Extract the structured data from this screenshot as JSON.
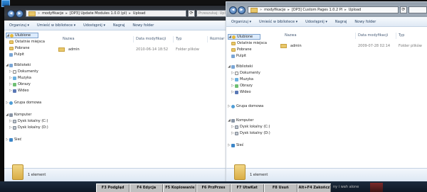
{
  "window_a": {
    "address": [
      "modyfikacje",
      "[DP3] Update Modules 1.0.0 (pl)",
      "Upload"
    ],
    "search_placeholder": "Przeszukaj: Upload",
    "toolbar": {
      "organize": "Organizuj ▾",
      "library": "Umieść w bibliotece ▾",
      "share": "Udostępnij ▾",
      "burn": "Nagraj",
      "new_folder": "Nowy folder"
    },
    "columns": {
      "name": "Nazwa",
      "date": "Data modyfikacji",
      "type": "Typ",
      "size": "Rozmiar"
    },
    "rows": [
      {
        "name": "admin",
        "date": "2010-06-14 18:52",
        "type": "Folder plików"
      }
    ],
    "status": "1 element"
  },
  "window_b": {
    "address": [
      "modyfikacje",
      "[DP3] Custom Pages 1.0.2 Pl",
      "Upload"
    ],
    "toolbar": {
      "organize": "Organizuj ▾",
      "library": "Umieść w bibliotece ▾",
      "share": "Udostępnij ▾",
      "burn": "Nagraj",
      "new_folder": "Nowy folder"
    },
    "columns": {
      "name": "Nazwa",
      "date": "Data modyfikacji",
      "type": "Typ"
    },
    "rows": [
      {
        "name": "admin",
        "date": "2009-07-28 02:14",
        "type": "Folder plików"
      }
    ],
    "status": "1 element"
  },
  "sidebar": {
    "favorites": "Ulubione",
    "recent": "Ostatnie miejsca",
    "downloads": "Pobrane",
    "desktop": "Pulpit",
    "libraries": "Biblioteki",
    "documents": "Dokumenty",
    "music": "Muzyka",
    "pictures": "Obrazy",
    "videos": "Wideo",
    "homegroup": "Grupa domowa",
    "computer": "Komputer",
    "drive_c": "Dysk lokalny (C:)",
    "drive_d": "Dysk lokalny (D:)",
    "network": "Sieć"
  },
  "fkeys": [
    "F3 Podgląd",
    "F4 Edycja",
    "F5 Kopiowanie",
    "F6 PrzPrzes",
    "F7 UtwKat",
    "F8 Usuń",
    "Alt+F4 Zakończ"
  ],
  "taskbar_snippet": "ny i wah alone"
}
